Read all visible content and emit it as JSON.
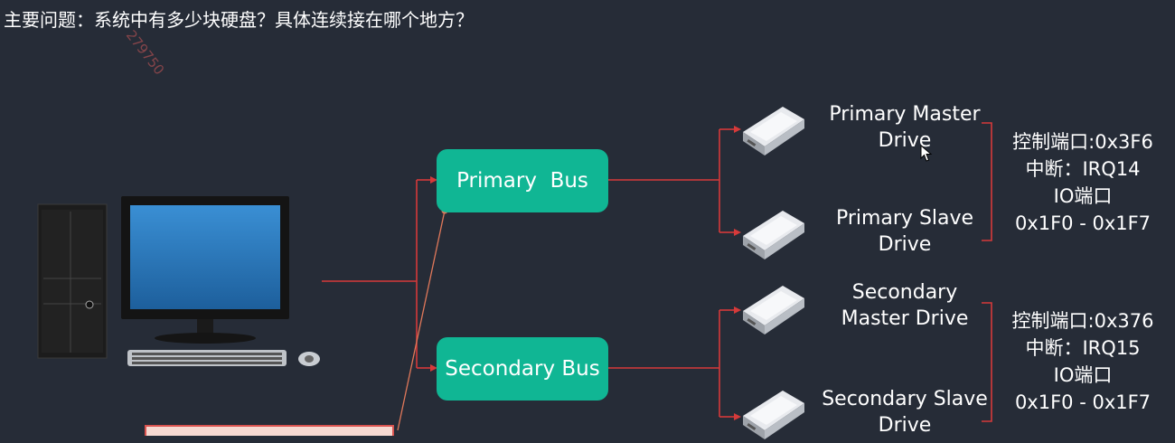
{
  "title": "主要问题：系统中有多少块硬盘？具体连续接在哪个地方？",
  "watermark": "279750",
  "buses": {
    "primary": "Primary  Bus",
    "secondary": "Secondary Bus"
  },
  "drives": {
    "primary_master": [
      "Primary Master",
      "Drive"
    ],
    "primary_slave": [
      "Primary Slave",
      "Drive"
    ],
    "secondary_master": [
      "Secondary",
      "Master Drive"
    ],
    "secondary_slave": [
      "Secondary Slave",
      "Drive"
    ]
  },
  "primary_info": {
    "control_port": "控制端口:0x3F6",
    "irq": "中断：IRQ14",
    "io_label": "IO端口",
    "io_range": "0x1F0 - 0x1F7"
  },
  "secondary_info": {
    "control_port": "控制端口:0x376",
    "irq": "中断：IRQ15",
    "io_label": "IO端口",
    "io_range": "0x1F0 - 0x1F7"
  },
  "colors": {
    "background": "#262c37",
    "bus": "#10b694",
    "wire": "#d63a3a",
    "annotation": "#e0785a"
  },
  "icons": [
    "desktop-computer-icon",
    "hard-drive-icon",
    "mouse-cursor-icon"
  ]
}
